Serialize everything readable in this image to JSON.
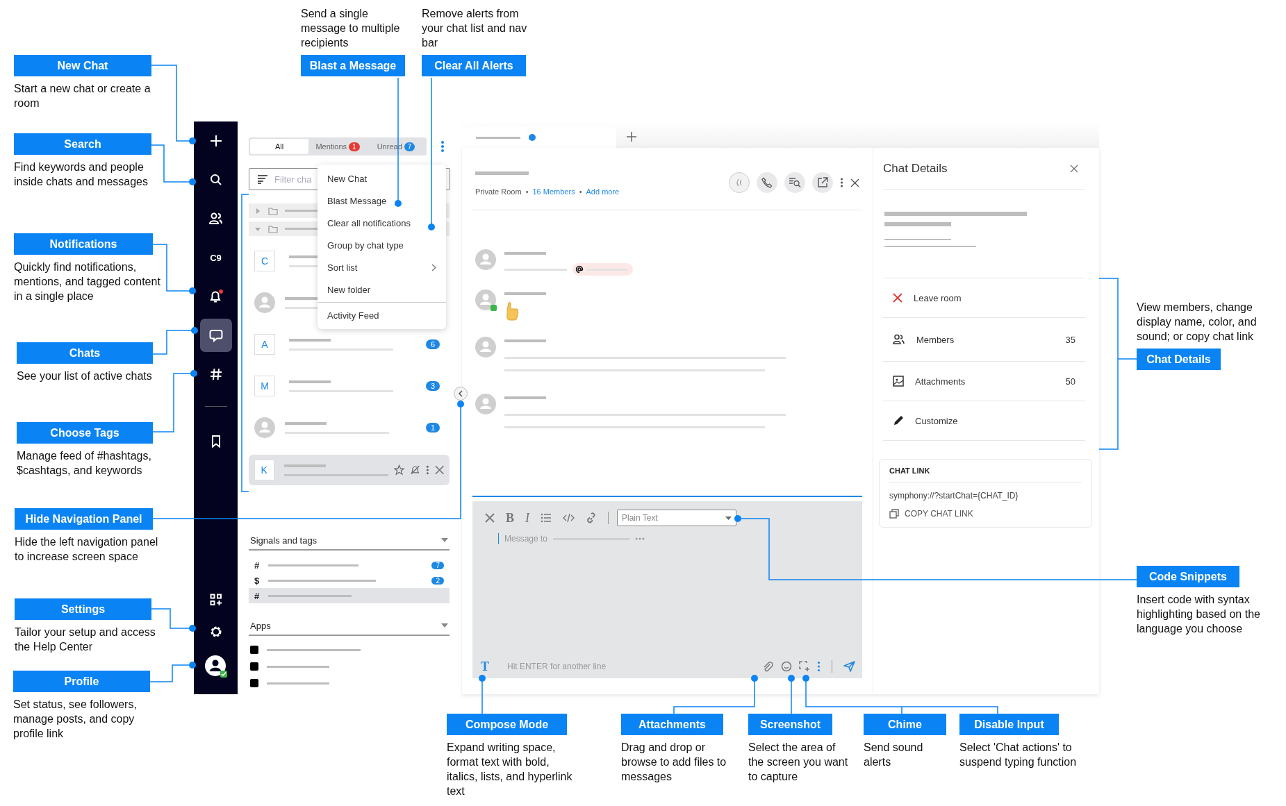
{
  "callouts": [
    {
      "title": "New Chat",
      "description": "Start a new chat or create a room"
    },
    {
      "title": "Search",
      "description": "Find keywords and people inside chats and messages"
    },
    {
      "title": "Notifications",
      "description": "Quickly find notifications, mentions, and tagged content in a single place"
    },
    {
      "title": "Chats",
      "description": "See your list of active chats"
    },
    {
      "title": "Choose Tags",
      "description": "Manage feed of #hashtags, $cashtags, and keywords"
    },
    {
      "title": "Hide Navigation Panel",
      "description": "Hide the left navigation panel to increase screen space"
    },
    {
      "title": "Settings",
      "description": "Tailor your setup and access the Help Center"
    },
    {
      "title": "Profile",
      "description": "Set status, see followers, manage posts, and copy profile link"
    },
    {
      "title": "Blast a Message",
      "description": "Send a single message to multiple recipients"
    },
    {
      "title": "Clear All Alerts",
      "description": "Remove alerts from your chat list and nav bar"
    },
    {
      "title": "Chat Details",
      "description": "View members, change display name, color, and sound; or copy chat link"
    },
    {
      "title": "Code Snippets",
      "description": "Insert code with syntax highlighting based on the language you choose"
    },
    {
      "title": "Compose Mode",
      "description": "Expand writing space, format text with bold, italics, lists, and hyperlink text"
    },
    {
      "title": "Attachments",
      "description": "Drag and drop or browse to add files to messages"
    },
    {
      "title": "Screenshot",
      "description": "Select the area of the screen you want to capture"
    },
    {
      "title": "Chime",
      "description": "Send sound alerts"
    },
    {
      "title": "Disable Input",
      "description": "Select 'Chat actions' to suspend typing function"
    }
  ],
  "nav": {
    "top": [
      {
        "kind": "new",
        "selected": false
      },
      {
        "kind": "search",
        "selected": false
      },
      {
        "kind": "contacts",
        "selected": false
      },
      {
        "kind": "label",
        "label": "C9",
        "selected": false
      },
      {
        "kind": "bell",
        "alert": true,
        "selected": false
      },
      {
        "kind": "chats",
        "selected": true
      },
      {
        "kind": "tags",
        "selected": false
      }
    ],
    "middle": [
      {
        "kind": "bookmark",
        "selected": false
      }
    ],
    "bottom": [
      {
        "kind": "apps",
        "selected": false
      },
      {
        "kind": "settings",
        "selected": false
      },
      {
        "kind": "profile",
        "online": true,
        "selected": false
      }
    ]
  },
  "chat_list": {
    "tabs": [
      {
        "label": "All",
        "selected": true
      },
      {
        "label": "Mentions",
        "count": "1",
        "color": "#e53935",
        "selected": false
      },
      {
        "label": "Unread",
        "count": "7",
        "color": "#1e88e5",
        "selected": false
      }
    ],
    "filter": {
      "placeholder": "Filter cha"
    },
    "folders": [
      {
        "expanded": false
      },
      {
        "expanded": true
      }
    ],
    "rows": [
      {
        "kind": "letter",
        "letter": "C",
        "selected": false
      },
      {
        "kind": "person",
        "selected": false
      },
      {
        "kind": "letter",
        "letter": "A",
        "badge": "6",
        "selected": false
      },
      {
        "kind": "letter",
        "letter": "M",
        "badge": "3",
        "selected": false
      },
      {
        "kind": "person",
        "badge": "1",
        "selected": false
      },
      {
        "kind": "letter",
        "letter": "K",
        "selected": true
      }
    ],
    "menu": [
      {
        "label": "New Chat"
      },
      {
        "label": "Blast Message"
      },
      {
        "label": "Clear all notifications"
      },
      {
        "label": "Group by chat type"
      },
      {
        "label": "Sort list",
        "submenu": true
      },
      {
        "label": "New folder"
      },
      {
        "label": "Activity Feed",
        "separated": true
      }
    ],
    "signals": {
      "title": "Signals and tags",
      "items": [
        {
          "symbol": "#",
          "badge": "7",
          "selected": false
        },
        {
          "symbol": "$",
          "badge": "2",
          "selected": false
        },
        {
          "symbol": "#",
          "selected": true
        }
      ]
    },
    "apps": {
      "title": "Apps",
      "items": [
        {
          "kind": "app"
        },
        {
          "kind": "app"
        },
        {
          "kind": "app"
        }
      ]
    }
  },
  "chat": {
    "tab": {
      "unread": true
    },
    "meta": {
      "room_type": "Private Room",
      "separators": [
        "•",
        "•"
      ],
      "members": "16 Members",
      "add": "Add more"
    },
    "messages": [
      {
        "kind": "mention",
        "online": false
      },
      {
        "kind": "reaction",
        "online": true
      },
      {
        "kind": "text",
        "online": false
      },
      {
        "kind": "text",
        "online": false
      }
    ],
    "toolbar": [
      {
        "kind": "clear"
      },
      {
        "kind": "bold",
        "glyph": "B"
      },
      {
        "kind": "italic",
        "glyph": "I"
      },
      {
        "kind": "list"
      },
      {
        "kind": "code"
      },
      {
        "kind": "link"
      }
    ],
    "format": "Plain Text",
    "placeholder": "Message to",
    "compose_glyph": "T",
    "hint": "Hit ENTER for another line"
  },
  "details": {
    "title": "Chat Details",
    "actions": [
      {
        "kind": "leave",
        "label": "Leave room"
      },
      {
        "kind": "members",
        "label": "Members",
        "count": "35"
      },
      {
        "kind": "attachments",
        "label": "Attachments",
        "count": "50"
      },
      {
        "kind": "customize",
        "label": "Customize"
      }
    ],
    "link": {
      "heading": "CHAT LINK",
      "url": "symphony://?startChat={CHAT_ID}",
      "copy": "COPY CHAT LINK"
    }
  }
}
